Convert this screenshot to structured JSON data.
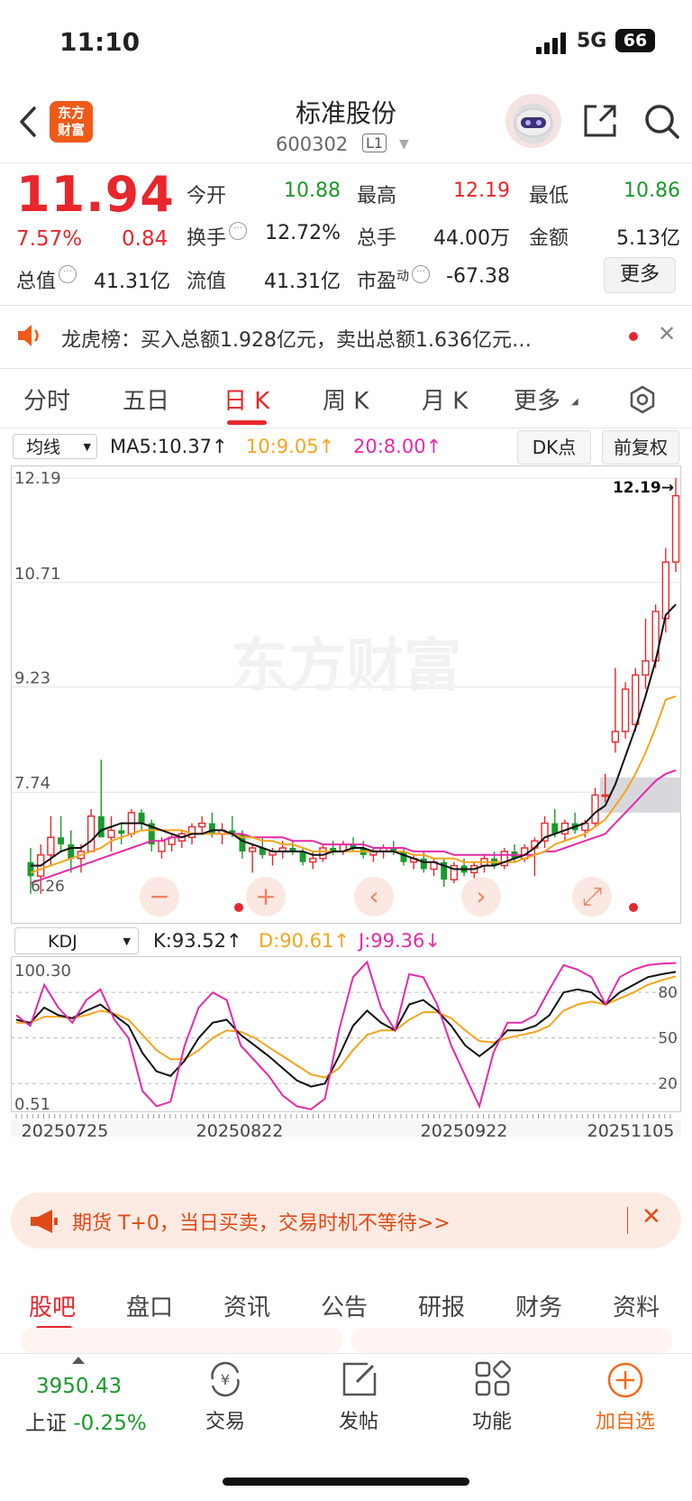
{
  "status_bar": {
    "time": "11:10",
    "network": "5G",
    "battery": "66"
  },
  "header": {
    "logo_text_1": "东方",
    "logo_text_2": "财富",
    "title": "标准股份",
    "code": "600302",
    "level": "L1"
  },
  "quote": {
    "price": "11.94",
    "change_pct": "7.57%",
    "change": "0.84",
    "open_label": "今开",
    "open": "10.88",
    "high_label": "最高",
    "high": "12.19",
    "low_label": "最低",
    "low": "10.86",
    "turnover_label": "换手",
    "turnover": "12.72%",
    "volume_label": "总手",
    "volume": "44.00万",
    "amount_label": "金额",
    "amount": "5.13亿",
    "mktcap_label": "总值",
    "mktcap": "41.31亿",
    "float_label": "流值",
    "float": "41.31亿",
    "pe_label": "市盈",
    "pe_sup": "动",
    "pe": "-67.38",
    "more_button": "更多"
  },
  "dragon_tiger": {
    "text": "龙虎榜：买入总额1.928亿元，卖出总额1.636亿元…"
  },
  "period_tabs": [
    "分时",
    "五日",
    "日 K",
    "周 K",
    "月 K",
    "更多"
  ],
  "ma_row": {
    "select": "均线",
    "ma5": "MA5:10.37",
    "ma10": "10:9.05",
    "ma20": "20:8.00",
    "dk_button": "DK点",
    "fq_button": "前复权",
    "ma5_arrow": "↑",
    "ma10_arrow": "↑",
    "ma20_arrow": "↑"
  },
  "watermark": "东方财富",
  "kdj_row": {
    "select": "KDJ",
    "k": "K:93.52",
    "d": "D:90.61",
    "j": "J:99.36",
    "k_arrow": "↑",
    "d_arrow": "↑",
    "j_arrow": "↓"
  },
  "colors": {
    "up": "#e8272c",
    "down": "#1a9a2c",
    "ma5": "#111111",
    "ma10": "#f3a51d",
    "ma20": "#e52aa8",
    "accent": "#ef6a1a"
  },
  "chart_data": [
    {
      "type": "candlestick",
      "y_ticks": [
        "12.19",
        "10.71",
        "9.23",
        "7.74"
      ],
      "ylim": [
        6.26,
        12.19
      ],
      "max_marker": "12.19→",
      "min_marker": "6.26",
      "candles": [
        {
          "o": 6.75,
          "h": 6.95,
          "l": 6.3,
          "c": 6.55
        },
        {
          "o": 6.55,
          "h": 7.0,
          "l": 6.3,
          "c": 6.85
        },
        {
          "o": 6.85,
          "h": 7.4,
          "l": 6.7,
          "c": 7.1
        },
        {
          "o": 7.1,
          "h": 7.4,
          "l": 6.9,
          "c": 7.0
        },
        {
          "o": 7.0,
          "h": 7.2,
          "l": 6.6,
          "c": 6.8
        },
        {
          "o": 6.8,
          "h": 7.0,
          "l": 6.6,
          "c": 6.9
        },
        {
          "o": 6.9,
          "h": 7.5,
          "l": 6.9,
          "c": 7.4
        },
        {
          "o": 7.4,
          "h": 8.2,
          "l": 7.2,
          "c": 7.1
        },
        {
          "o": 7.1,
          "h": 7.4,
          "l": 6.9,
          "c": 7.2
        },
        {
          "o": 7.2,
          "h": 7.3,
          "l": 7.0,
          "c": 7.15
        },
        {
          "o": 7.15,
          "h": 7.5,
          "l": 7.1,
          "c": 7.45
        },
        {
          "o": 7.45,
          "h": 7.5,
          "l": 7.2,
          "c": 7.3
        },
        {
          "o": 7.3,
          "h": 7.35,
          "l": 6.9,
          "c": 7.0
        },
        {
          "o": 6.9,
          "h": 7.1,
          "l": 6.8,
          "c": 7.05
        },
        {
          "o": 7.0,
          "h": 7.15,
          "l": 6.9,
          "c": 7.1
        },
        {
          "o": 7.05,
          "h": 7.2,
          "l": 6.95,
          "c": 7.15
        },
        {
          "o": 7.1,
          "h": 7.3,
          "l": 7.0,
          "c": 7.25
        },
        {
          "o": 7.25,
          "h": 7.4,
          "l": 7.15,
          "c": 7.3
        },
        {
          "o": 7.3,
          "h": 7.45,
          "l": 7.1,
          "c": 7.15
        },
        {
          "o": 7.15,
          "h": 7.3,
          "l": 7.0,
          "c": 7.2
        },
        {
          "o": 7.2,
          "h": 7.4,
          "l": 7.1,
          "c": 7.15
        },
        {
          "o": 7.15,
          "h": 7.2,
          "l": 6.8,
          "c": 6.9
        },
        {
          "o": 6.9,
          "h": 7.0,
          "l": 6.6,
          "c": 6.95
        },
        {
          "o": 6.95,
          "h": 7.1,
          "l": 6.8,
          "c": 6.85
        },
        {
          "o": 6.85,
          "h": 6.95,
          "l": 6.7,
          "c": 6.9
        },
        {
          "o": 6.9,
          "h": 7.05,
          "l": 6.8,
          "c": 6.95
        },
        {
          "o": 6.95,
          "h": 7.05,
          "l": 6.85,
          "c": 6.9
        },
        {
          "o": 6.9,
          "h": 6.95,
          "l": 6.7,
          "c": 6.75
        },
        {
          "o": 6.75,
          "h": 6.9,
          "l": 6.65,
          "c": 6.8
        },
        {
          "o": 6.8,
          "h": 7.0,
          "l": 6.75,
          "c": 6.95
        },
        {
          "o": 6.95,
          "h": 7.05,
          "l": 6.85,
          "c": 6.9
        },
        {
          "o": 6.9,
          "h": 7.05,
          "l": 6.85,
          "c": 7.0
        },
        {
          "o": 7.0,
          "h": 7.1,
          "l": 6.9,
          "c": 6.95
        },
        {
          "o": 6.95,
          "h": 7.05,
          "l": 6.8,
          "c": 6.85
        },
        {
          "o": 6.85,
          "h": 6.95,
          "l": 6.75,
          "c": 6.9
        },
        {
          "o": 6.9,
          "h": 7.0,
          "l": 6.8,
          "c": 6.95
        },
        {
          "o": 6.95,
          "h": 7.05,
          "l": 6.85,
          "c": 6.9
        },
        {
          "o": 6.9,
          "h": 6.95,
          "l": 6.7,
          "c": 6.75
        },
        {
          "o": 6.75,
          "h": 6.85,
          "l": 6.65,
          "c": 6.8
        },
        {
          "o": 6.8,
          "h": 6.9,
          "l": 6.6,
          "c": 6.65
        },
        {
          "o": 6.65,
          "h": 6.8,
          "l": 6.55,
          "c": 6.75
        },
        {
          "o": 6.75,
          "h": 6.8,
          "l": 6.4,
          "c": 6.5
        },
        {
          "o": 6.5,
          "h": 6.75,
          "l": 6.45,
          "c": 6.7
        },
        {
          "o": 6.7,
          "h": 6.8,
          "l": 6.55,
          "c": 6.6
        },
        {
          "o": 6.6,
          "h": 6.75,
          "l": 6.5,
          "c": 6.7
        },
        {
          "o": 6.7,
          "h": 6.85,
          "l": 6.6,
          "c": 6.8
        },
        {
          "o": 6.8,
          "h": 6.9,
          "l": 6.65,
          "c": 6.7
        },
        {
          "o": 6.7,
          "h": 6.95,
          "l": 6.65,
          "c": 6.9
        },
        {
          "o": 6.9,
          "h": 7.0,
          "l": 6.75,
          "c": 6.8
        },
        {
          "o": 6.8,
          "h": 7.0,
          "l": 6.75,
          "c": 6.95
        },
        {
          "o": 6.95,
          "h": 7.1,
          "l": 6.55,
          "c": 7.05
        },
        {
          "o": 7.05,
          "h": 7.4,
          "l": 6.95,
          "c": 7.3
        },
        {
          "o": 7.3,
          "h": 7.5,
          "l": 7.1,
          "c": 7.15
        },
        {
          "o": 7.15,
          "h": 7.35,
          "l": 7.05,
          "c": 7.3
        },
        {
          "o": 7.3,
          "h": 7.45,
          "l": 7.15,
          "c": 7.2
        },
        {
          "o": 7.2,
          "h": 7.35,
          "l": 7.1,
          "c": 7.3
        },
        {
          "o": 7.3,
          "h": 7.8,
          "l": 7.25,
          "c": 7.7
        },
        {
          "o": 7.7,
          "h": 8.0,
          "l": 7.6,
          "c": 7.7
        },
        {
          "o": 8.45,
          "h": 9.5,
          "l": 8.3,
          "c": 8.6
        },
        {
          "o": 8.6,
          "h": 9.3,
          "l": 8.5,
          "c": 9.2
        },
        {
          "o": 8.7,
          "h": 9.5,
          "l": 8.6,
          "c": 9.4
        },
        {
          "o": 9.4,
          "h": 10.2,
          "l": 9.2,
          "c": 9.6
        },
        {
          "o": 9.6,
          "h": 10.4,
          "l": 9.5,
          "c": 10.3
        },
        {
          "o": 10.2,
          "h": 11.2,
          "l": 10.0,
          "c": 11.0
        },
        {
          "o": 11.0,
          "h": 12.19,
          "l": 10.86,
          "c": 11.94
        }
      ],
      "ma5": [
        6.7,
        6.7,
        6.8,
        6.9,
        6.95,
        6.95,
        7.05,
        7.2,
        7.25,
        7.3,
        7.3,
        7.3,
        7.25,
        7.2,
        7.15,
        7.1,
        7.15,
        7.15,
        7.2,
        7.2,
        7.15,
        7.05,
        7.0,
        6.95,
        6.9,
        6.9,
        6.9,
        6.9,
        6.85,
        6.85,
        6.9,
        6.9,
        6.95,
        6.95,
        6.9,
        6.9,
        6.9,
        6.85,
        6.8,
        6.75,
        6.75,
        6.7,
        6.65,
        6.65,
        6.65,
        6.7,
        6.7,
        6.75,
        6.8,
        6.85,
        6.95,
        7.1,
        7.15,
        7.2,
        7.25,
        7.3,
        7.45,
        7.55,
        7.85,
        8.25,
        8.65,
        9.1,
        9.6,
        10.25,
        10.4
      ],
      "ma10": [
        6.6,
        6.65,
        6.7,
        6.75,
        6.8,
        6.85,
        6.9,
        6.95,
        7.05,
        7.1,
        7.15,
        7.2,
        7.2,
        7.2,
        7.2,
        7.2,
        7.15,
        7.15,
        7.15,
        7.15,
        7.15,
        7.1,
        7.1,
        7.05,
        7.05,
        7.0,
        7.0,
        6.95,
        6.9,
        6.9,
        6.9,
        6.9,
        6.9,
        6.9,
        6.9,
        6.9,
        6.9,
        6.9,
        6.85,
        6.85,
        6.8,
        6.8,
        6.8,
        6.75,
        6.75,
        6.75,
        6.75,
        6.75,
        6.75,
        6.8,
        6.85,
        6.9,
        7.0,
        7.05,
        7.1,
        7.15,
        7.25,
        7.35,
        7.55,
        7.75,
        8.0,
        8.3,
        8.65,
        9.05,
        9.1
      ],
      "ma20": [
        6.45,
        6.5,
        6.55,
        6.6,
        6.65,
        6.7,
        6.75,
        6.8,
        6.85,
        6.9,
        6.95,
        7.0,
        7.05,
        7.05,
        7.1,
        7.1,
        7.15,
        7.15,
        7.15,
        7.15,
        7.15,
        7.15,
        7.1,
        7.1,
        7.1,
        7.1,
        7.05,
        7.05,
        7.05,
        7.0,
        7.0,
        7.0,
        7.0,
        7.0,
        6.95,
        6.95,
        6.95,
        6.95,
        6.9,
        6.9,
        6.9,
        6.9,
        6.85,
        6.85,
        6.85,
        6.85,
        6.85,
        6.85,
        6.85,
        6.85,
        6.85,
        6.9,
        6.9,
        6.95,
        7.0,
        7.05,
        7.1,
        7.15,
        7.3,
        7.45,
        7.6,
        7.75,
        7.9,
        8.0,
        8.05
      ]
    },
    {
      "type": "line",
      "y_ticks": [
        "100.30",
        "0.51"
      ],
      "ref_lines": [
        "80",
        "50",
        "20"
      ],
      "ylim": [
        0.51,
        100.3
      ],
      "x_labels": [
        "20250725",
        "20250822",
        "20250922",
        "20251105"
      ],
      "series": [
        {
          "name": "K",
          "values": [
            62,
            60,
            70,
            65,
            63,
            68,
            72,
            65,
            58,
            40,
            28,
            25,
            35,
            50,
            60,
            62,
            52,
            45,
            38,
            30,
            22,
            18,
            20,
            38,
            58,
            68,
            60,
            55,
            72,
            75,
            68,
            58,
            45,
            38,
            45,
            55,
            55,
            58,
            65,
            80,
            82,
            80,
            72,
            80,
            85,
            90,
            92,
            93.5
          ]
        },
        {
          "name": "D",
          "values": [
            60,
            60,
            64,
            64,
            63,
            65,
            68,
            66,
            62,
            52,
            42,
            36,
            36,
            42,
            50,
            55,
            54,
            50,
            44,
            38,
            32,
            26,
            24,
            30,
            42,
            52,
            55,
            55,
            62,
            67,
            67,
            63,
            55,
            48,
            47,
            50,
            52,
            54,
            58,
            68,
            72,
            74,
            72,
            76,
            80,
            85,
            88,
            90.6
          ]
        },
        {
          "name": "J",
          "values": [
            65,
            58,
            85,
            70,
            60,
            75,
            82,
            62,
            50,
            15,
            5,
            8,
            45,
            70,
            80,
            75,
            45,
            35,
            25,
            12,
            5,
            3,
            10,
            55,
            90,
            100,
            70,
            55,
            92,
            90,
            72,
            45,
            25,
            5,
            40,
            60,
            60,
            65,
            82,
            98,
            95,
            90,
            72,
            90,
            95,
            98,
            99,
            99.36
          ]
        }
      ]
    }
  ],
  "promo": {
    "text": "期货 T+0，当日买卖，交易时机不等待>>"
  },
  "bottom_tabs": [
    "股吧",
    "盘口",
    "资讯",
    "公告",
    "研报",
    "财务",
    "资料"
  ],
  "bottom_nav": {
    "index_value": "3950.43",
    "index_name": "上证",
    "index_change": "-0.25%",
    "trade": "交易",
    "post": "发帖",
    "func": "功能",
    "add": "加自选"
  }
}
